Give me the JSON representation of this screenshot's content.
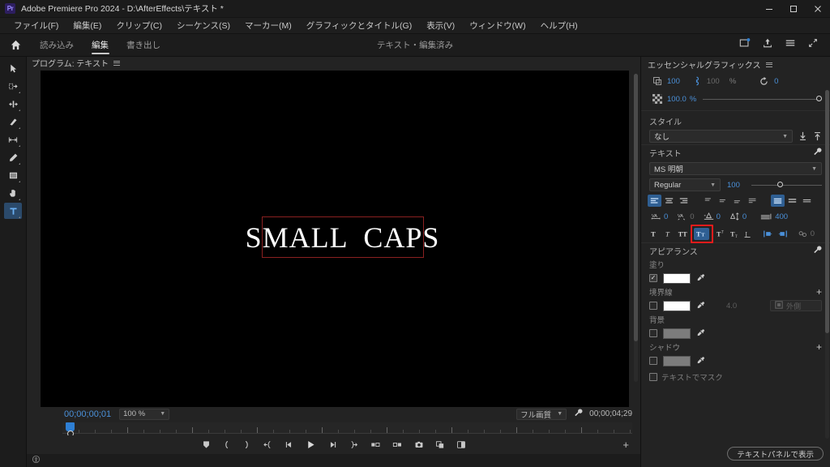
{
  "window": {
    "title": "Adobe Premiere Pro 2024 - D:\\AfterEffects\\テキスト *",
    "logo_text": "Pr",
    "minimize": "minimize-icon",
    "maximize": "maximize-icon",
    "close": "close-icon"
  },
  "menubar": {
    "items": [
      {
        "label": "ファイル(F)"
      },
      {
        "label": "編集(E)"
      },
      {
        "label": "クリップ(C)"
      },
      {
        "label": "シーケンス(S)"
      },
      {
        "label": "マーカー(M)"
      },
      {
        "label": "グラフィックとタイトル(G)"
      },
      {
        "label": "表示(V)"
      },
      {
        "label": "ウィンドウ(W)"
      },
      {
        "label": "ヘルプ(H)"
      }
    ]
  },
  "workspace": {
    "home_icon": "home-icon",
    "tabs": [
      {
        "label": "読み込み",
        "active": false
      },
      {
        "label": "編集",
        "active": true
      },
      {
        "label": "書き出し",
        "active": false
      }
    ],
    "center_title": "テキスト・編集済み",
    "right_icons": [
      "new-project-icon",
      "export-icon",
      "list-view-icon",
      "fullscreen-icon"
    ]
  },
  "tools": [
    {
      "name": "selection-tool",
      "glyph": "selection",
      "active": false
    },
    {
      "name": "track-select-forward-tool",
      "glyph": "track-select",
      "active": false
    },
    {
      "name": "ripple-edit-tool",
      "glyph": "ripple-edit",
      "active": false
    },
    {
      "name": "razor-tool",
      "glyph": "razor",
      "active": false
    },
    {
      "name": "slip-tool",
      "glyph": "slip",
      "active": false
    },
    {
      "name": "pen-tool",
      "glyph": "pen",
      "active": false
    },
    {
      "name": "rectangle-tool",
      "glyph": "rectangle",
      "active": false
    },
    {
      "name": "hand-tool",
      "glyph": "hand",
      "active": false
    },
    {
      "name": "type-tool",
      "glyph": "T",
      "active": true
    }
  ],
  "monitor": {
    "panel_tab": "プログラム: テキスト",
    "canvas_text": "SMALL  CAPS",
    "playhead_timecode": "00;00;00;01",
    "zoom_level": "100 %",
    "quality": "フル画質",
    "duration": "00;00;04;29",
    "settings_icon": "wrench-icon",
    "transport_buttons": [
      "add-marker-icon",
      "mark-in-icon",
      "mark-out-icon",
      "go-to-in-icon",
      "step-back-icon",
      "play-icon",
      "step-forward-icon",
      "go-to-out-icon",
      "lift-icon",
      "extract-icon",
      "export-frame-icon",
      "comparison-view-icon",
      "multicam-icon"
    ],
    "button_editor": "+"
  },
  "essential_graphics": {
    "panel_title": "エッセンシャルグラフィックス",
    "transform": {
      "scale_icon": "scale-icon",
      "scale_value": "100",
      "lock_icon": "link-icon",
      "scale_height_value": "100",
      "percent_label": "%",
      "rotation_icon": "rotation-icon",
      "rotation_value": "0",
      "opacity_icon": "opacity-icon",
      "opacity_value": "100.0",
      "opacity_percent": "%"
    },
    "style": {
      "label": "スタイル",
      "value": "なし",
      "push_icon": "push-down-icon",
      "pull_icon": "push-up-icon"
    },
    "text": {
      "label": "テキスト",
      "wrench_icon": "wrench-icon",
      "font_family": "MS 明朝",
      "font_style": "Regular",
      "font_size": "100",
      "align_buttons": [
        {
          "name": "align-left-button",
          "glyph": "align-left",
          "active": true
        },
        {
          "name": "align-center-button",
          "glyph": "align-center",
          "active": false
        },
        {
          "name": "align-right-button",
          "glyph": "align-right",
          "active": false
        },
        {
          "name": "align-top-button",
          "glyph": "vtop",
          "active": false
        },
        {
          "name": "align-middle-button",
          "glyph": "vmiddle",
          "active": false
        },
        {
          "name": "align-bottom-button",
          "glyph": "vbottom",
          "active": false
        },
        {
          "name": "justify-last-left-button",
          "glyph": "justify-left",
          "active": false
        },
        {
          "name": "justify-all-button",
          "glyph": "justify-all",
          "active": true
        },
        {
          "name": "distribute-button",
          "glyph": "distribute",
          "active": false
        },
        {
          "name": "text-flow-button",
          "glyph": "flow",
          "active": false
        }
      ],
      "metrics": [
        {
          "name": "tracking",
          "icon": "tracking-icon",
          "value": "0"
        },
        {
          "name": "kerning",
          "icon": "kerning-icon",
          "value": "0"
        },
        {
          "name": "baseline-shift",
          "icon": "baseline-shift-icon",
          "value": "0"
        },
        {
          "name": "leading",
          "icon": "leading-icon",
          "value": "0"
        },
        {
          "name": "line-spacing",
          "icon": "line-spacing-icon",
          "value": "400"
        }
      ],
      "style_buttons": [
        {
          "name": "faux-bold-button",
          "glyph": "T",
          "active": false
        },
        {
          "name": "faux-italic-button",
          "glyph": "T-italic",
          "active": false
        },
        {
          "name": "all-caps-button",
          "glyph": "TT",
          "active": false
        },
        {
          "name": "small-caps-button",
          "glyph": "Tt",
          "active": true,
          "highlighted": true
        },
        {
          "name": "superscript-button",
          "glyph": "T-sup",
          "active": false
        },
        {
          "name": "subscript-button",
          "glyph": "T-sub",
          "active": false
        },
        {
          "name": "underline-button",
          "glyph": "T-underline",
          "active": false
        }
      ],
      "direction_buttons": [
        {
          "name": "text-direction-horizontal-button",
          "glyph": "dir-h"
        },
        {
          "name": "text-direction-vertical-button",
          "glyph": "dir-v"
        }
      ],
      "tsume_icon": "tsume-icon",
      "tsume_value": "0"
    },
    "appearance": {
      "label": "アピアランス",
      "wrench_icon": "wrench-icon",
      "fill": {
        "label": "塗り",
        "checked": true,
        "color": "#ffffff",
        "eyedropper": "eyedropper-icon"
      },
      "stroke": {
        "label": "境界線",
        "checked": false,
        "color": "#ffffff",
        "eyedropper": "eyedropper-icon",
        "width": "4.0",
        "mode": "外側",
        "mode_icon": "stroke-outer-icon",
        "add": "+"
      },
      "background": {
        "label": "背景",
        "checked": false,
        "color": "#7c7c7c",
        "eyedropper": "eyedropper-icon"
      },
      "shadow": {
        "label": "シャドウ",
        "checked": false,
        "color": "#7c7c7c",
        "eyedropper": "eyedropper-icon",
        "add": "+"
      },
      "mask_with_text": {
        "label": "テキストでマスク",
        "checked": false
      }
    },
    "footer_button": "テキストパネルで表示"
  },
  "colors": {
    "accent_blue": "#4a90d9",
    "active_button": "#2f5f93",
    "highlight_red": "#e81b1b",
    "selection_box": "#8a2020",
    "panel_bg": "#232323"
  }
}
